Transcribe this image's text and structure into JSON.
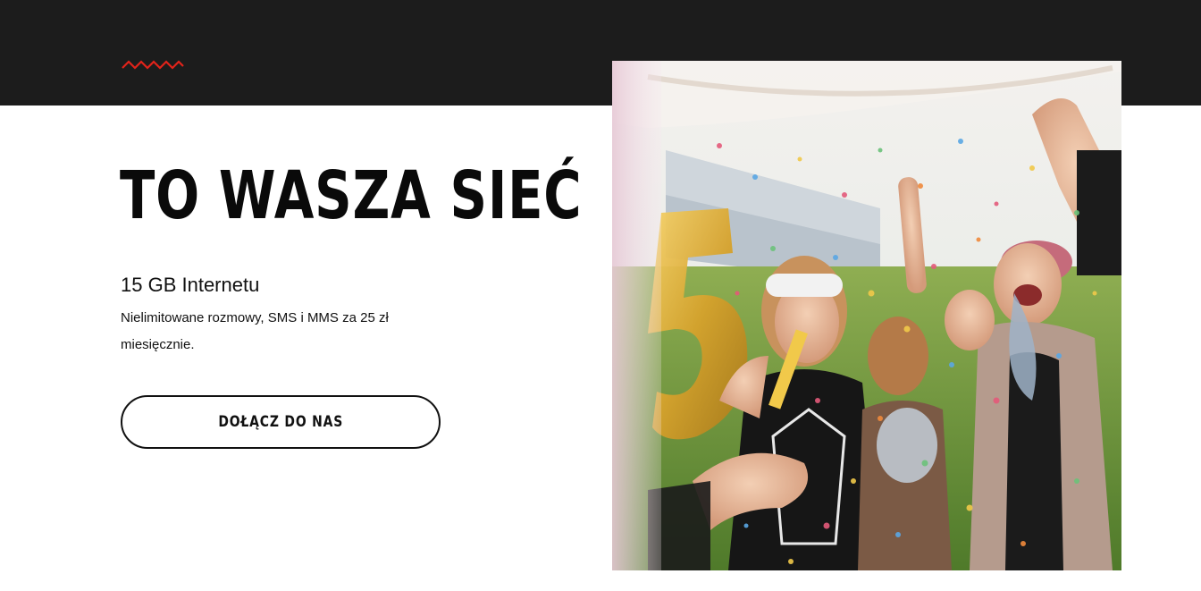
{
  "hero": {
    "title": "TO WASZA SIEĆ",
    "subtitle": "15 GB Internetu",
    "description": "Nielimitowane rozmowy, SMS i MMS za 25 zł miesięcznie.",
    "cta_label": "DOŁĄCZ DO NAS"
  },
  "decor": {
    "squiggle_icon": "zigzag-icon",
    "accent_color": "#e2231a",
    "header_band_color": "#1c1c1c"
  },
  "image": {
    "subject": "party-photo"
  }
}
